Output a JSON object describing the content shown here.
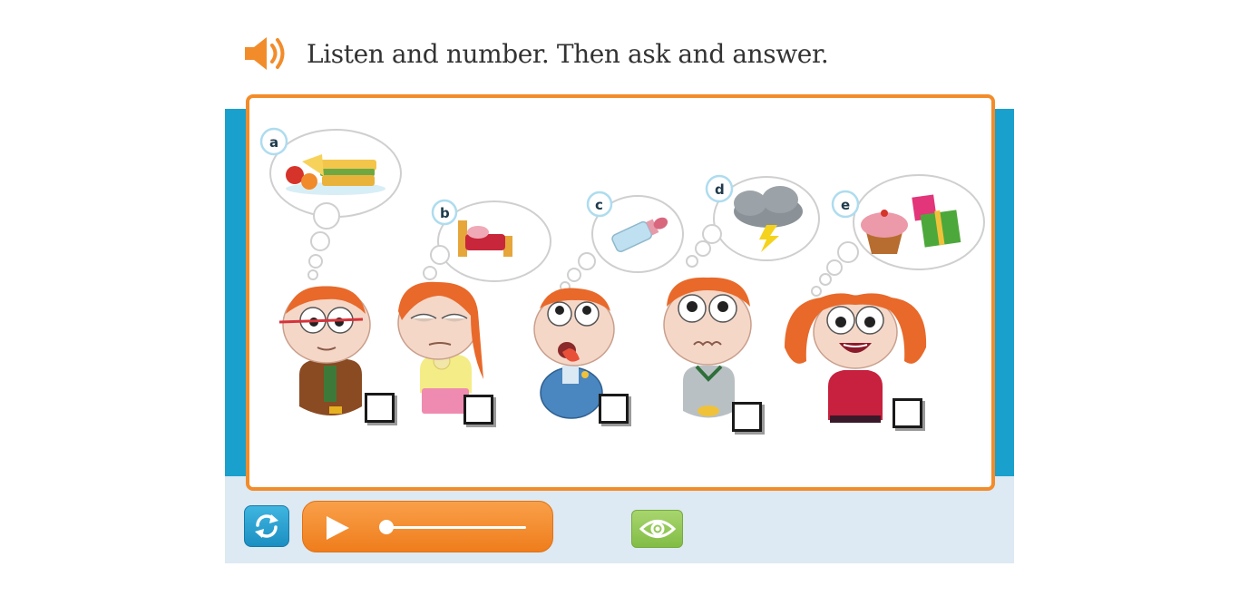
{
  "header": {
    "instruction": "Listen and number. Then ask and answer.",
    "audio_icon": "speaker-icon"
  },
  "activity": {
    "items": [
      {
        "letter": "a",
        "thought": "sandwich-and-fruit",
        "character": "boy-with-glasses",
        "answer": ""
      },
      {
        "letter": "b",
        "thought": "bed",
        "character": "tired-girl",
        "answer": ""
      },
      {
        "letter": "c",
        "thought": "bottle",
        "character": "thirsty-boy",
        "answer": ""
      },
      {
        "letter": "d",
        "thought": "storm-cloud",
        "character": "scared-boy",
        "answer": ""
      },
      {
        "letter": "e",
        "thought": "cupcake-and-presents",
        "character": "happy-girl",
        "answer": ""
      }
    ]
  },
  "controls": {
    "reset_icon": "refresh-icon",
    "play_icon": "play-icon",
    "reveal_icon": "eye-icon",
    "audio_progress": 0.0
  },
  "colors": {
    "accent_orange": "#f28c2a",
    "panel_blue": "#1aa0cc",
    "panel_light": "#dde9f3",
    "reveal_green": "#8cc453"
  }
}
